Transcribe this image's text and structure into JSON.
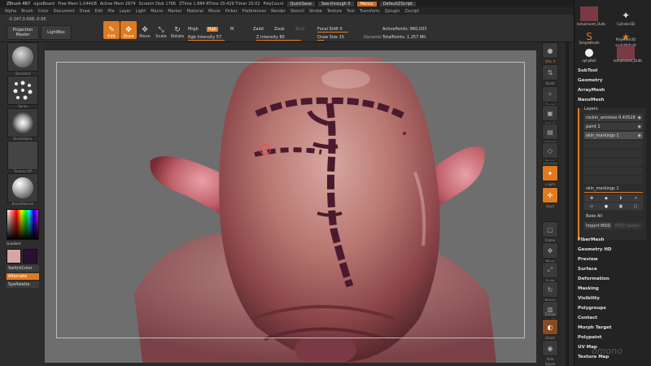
{
  "titlebar": {
    "app": "ZBrush 4R7",
    "doc": "ogreBoard",
    "free_mem": "Free Mem 1.044GB",
    "active_mem": "Active Mem 2674",
    "scratch": "Scratch Disk 1766",
    "ztime": "ZTime 1.884 RTime 20.429 Timer 20.02",
    "polycount": "PolyCount",
    "quicksave": "QuickSave",
    "seethrough": "See-through  0",
    "menus": "Menus",
    "script": "DefaultZScript"
  },
  "menubar": [
    "Alpha",
    "Brush",
    "Color",
    "Document",
    "Draw",
    "Edit",
    "File",
    "Layer",
    "Light",
    "Macro",
    "Marker",
    "Material",
    "Movie",
    "Picker",
    "Preferences",
    "Render",
    "Stencil",
    "Stroke",
    "Texture",
    "Tool",
    "Transform",
    "Zplugin",
    "Zscript"
  ],
  "shelf": {
    "coord": "-0.247,0.698,-0.95",
    "projection_master": "Projection Master",
    "lightbox": "LightBox",
    "tools": [
      {
        "label": "Edit",
        "glyph": "✎"
      },
      {
        "label": "Draw",
        "glyph": "✥"
      },
      {
        "label": "Move",
        "glyph": "✥"
      },
      {
        "label": "Scale",
        "glyph": "⤡"
      },
      {
        "label": "Rotate",
        "glyph": "↻"
      }
    ],
    "mrgb": "Mrgb",
    "rgb": "Rgb",
    "m": "M",
    "rgb_intensity": "Rgb Intensity 57",
    "zadd": "Zadd",
    "zsub": "Zsub",
    "zcut": "Zcut",
    "z_intensity": "Z Intensity 80",
    "focal_shift": "Focal Shift 0",
    "draw_size": "Draw Size 15",
    "dynamic": "Dynamic",
    "active_points": "ActivePoints: 960,033",
    "total_points": "TotalPoints: 1.257 Mil"
  },
  "left": {
    "labels": [
      "Standard",
      "Spray",
      "BrushAlpha",
      "Texture Off",
      "BasicMaterial"
    ],
    "gradient": "Gradient",
    "switchcolor": "SwitchColor",
    "alternate": "Alternate",
    "sygpalette": "SyePalette"
  },
  "rightcol": [
    "SPix 3",
    "Scroll",
    "Zoom",
    "Actual",
    "AAHalf",
    "Persp",
    "Floor",
    "L.Sym",
    "Qxyz",
    "Frame",
    "Move",
    "Scale",
    "Rotate",
    "Line Fill",
    "Transp",
    "Ghost",
    "Solo",
    "Xpose"
  ],
  "palette": {
    "brushes": [
      "lamulmaret_Dutb",
      "Cylinder3D",
      "SimpleBrush",
      "PolyMesh3D",
      "sculptArtivat",
      "sphyBall",
      "lamulmaret_Dutb"
    ],
    "sections_top": [
      "SubTool",
      "Geometry",
      "ArrayMesh",
      "NanoMesh",
      "Layers"
    ],
    "layers": [
      {
        "name": "rockin_wrinkles 0.43528"
      },
      {
        "name": "paint 1"
      },
      {
        "name": "skin_markings 1"
      }
    ],
    "active_layer": "skin_markings 1",
    "bake_all": "Bake All",
    "import_mdd": "Import MDD",
    "speed": "MDD Speed",
    "sections_bottom": [
      "FiberMesh",
      "Geometry HD",
      "Preview",
      "Surface",
      "Deformation",
      "Masking",
      "Visibility",
      "Polygroups",
      "Contact",
      "Morph Target",
      "Polypaint",
      "UV Map",
      "Texture Map"
    ]
  },
  "watermark": "omono"
}
